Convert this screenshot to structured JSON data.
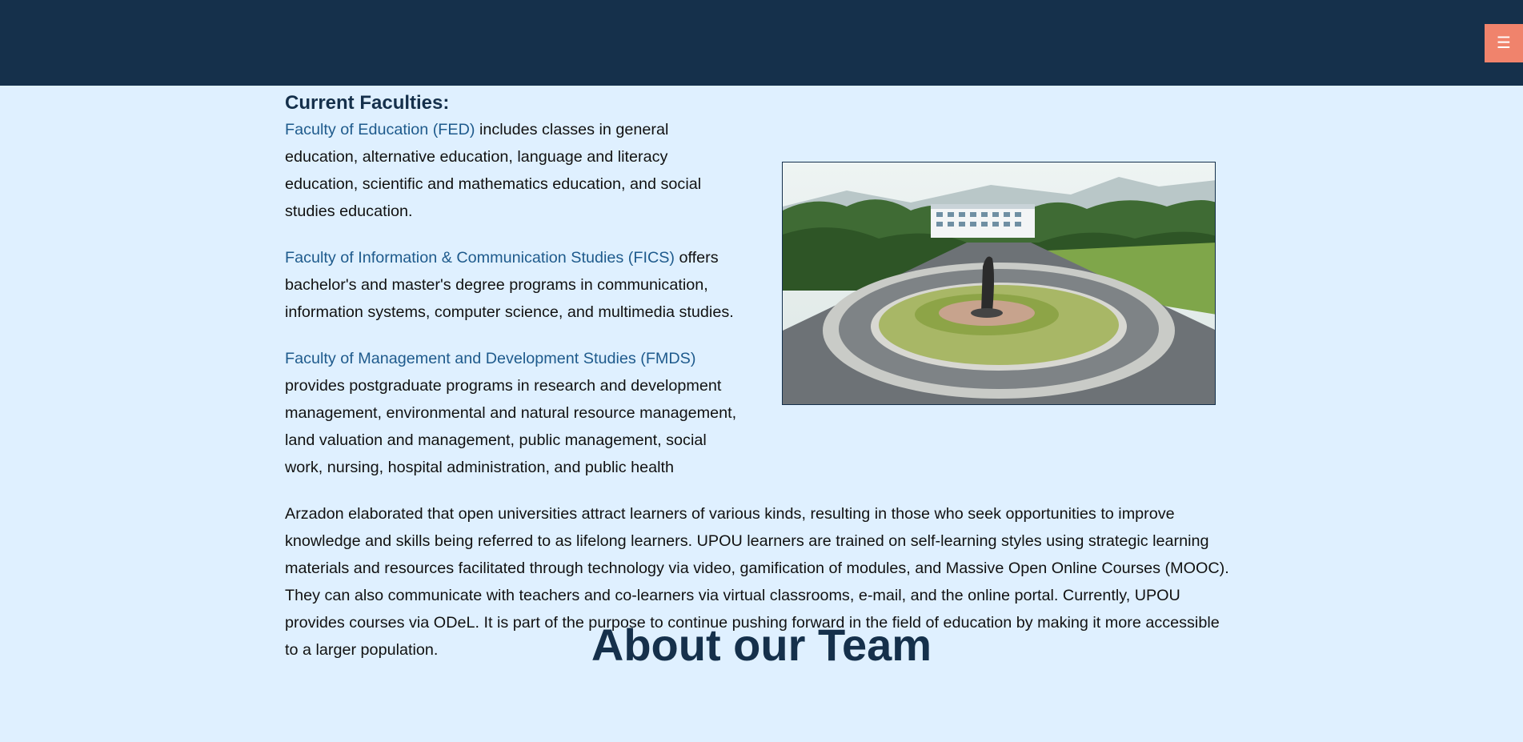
{
  "header": {
    "menu_icon": "☰"
  },
  "faculties": {
    "heading": "Current Faculties:",
    "items": [
      {
        "link": "Faculty of Education (FED)",
        "text": " includes classes in general education, alternative education, language and literacy education, scientific and mathematics education, and social studies education."
      },
      {
        "link": "Faculty of Information & Communication Studies (FICS)",
        "text": " offers bachelor's and master's degree programs in communication, information systems, computer science, and multimedia studies."
      },
      {
        "link": "Faculty of Management and Development Studies (FMDS)",
        "text": " provides postgraduate programs in research and development management, environmental and natural resource management, land valuation and management, public management, social work, nursing, hospital administration, and public health"
      }
    ]
  },
  "body_paragraph": "Arzadon elaborated that open universities attract learners of various kinds, resulting in those who seek opportunities to improve knowledge and skills being referred to as lifelong learners. UPOU learners are trained on self-learning styles using strategic learning materials and resources facilitated through technology via video, gamification of modules, and Massive Open Online Courses (MOOC). They can also communicate with teachers and co-learners via virtual classrooms, e-mail, and the online portal. Currently, UPOU provides courses via ODeL. It is part of the purpose to continue pushing forward in the field of education by making it more accessible to a larger population.",
  "team_title": "About our Team"
}
